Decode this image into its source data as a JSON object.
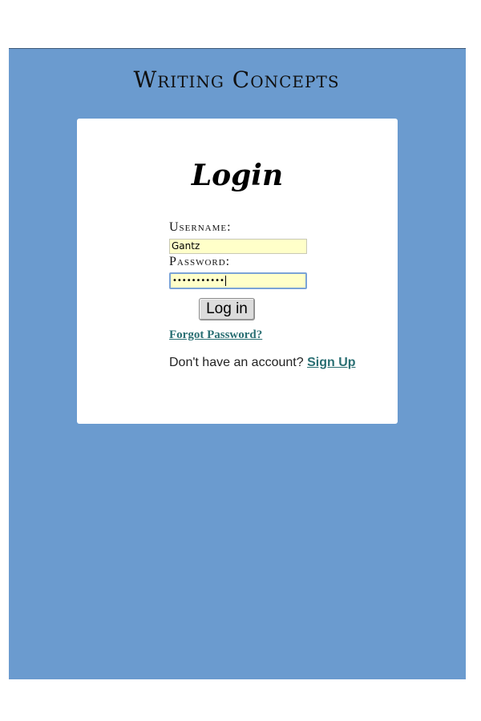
{
  "site": {
    "title": "Writing Concepts"
  },
  "login": {
    "heading": "Login",
    "username_label": "Username:",
    "username_value": "Gantz",
    "password_label": "Password:",
    "password_masked": "•••••••••••",
    "login_button_label": "Log in",
    "forgot_password_label": "Forgot Password?",
    "no_account_text": "Don't have an account?",
    "signup_label": "Sign Up"
  },
  "colors": {
    "page_background": "#6b9bcf",
    "card_background": "#ffffff",
    "input_background": "#ffffc9",
    "link": "#2a6f73"
  }
}
